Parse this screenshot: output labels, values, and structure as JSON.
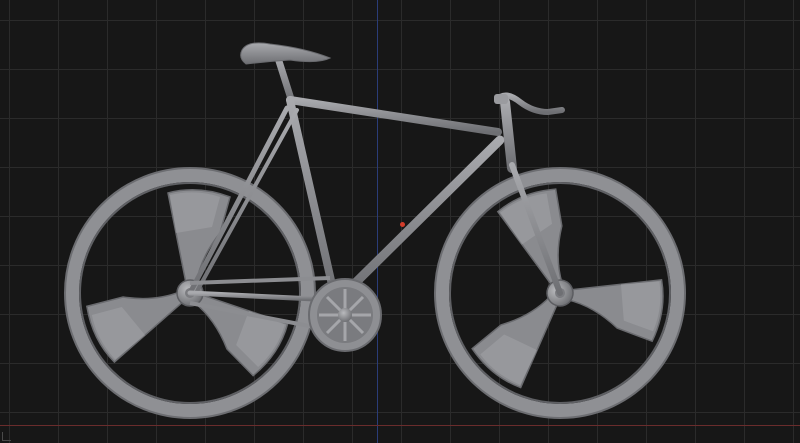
{
  "viewport": {
    "background": "#171717",
    "grid_color": "#2b2b2b",
    "axis_y_color": "#2a3c78",
    "axis_x_color": "#6a2c2c",
    "origin_marker_color": "#d23c2a"
  },
  "model": {
    "object": "bicycle",
    "material_color": "#8d8e92",
    "wheel_style": "three-spoke-blade",
    "parts": [
      "saddle",
      "seat-post",
      "frame",
      "fork",
      "handlebar",
      "front-wheel",
      "rear-wheel",
      "chainring",
      "chain"
    ]
  }
}
